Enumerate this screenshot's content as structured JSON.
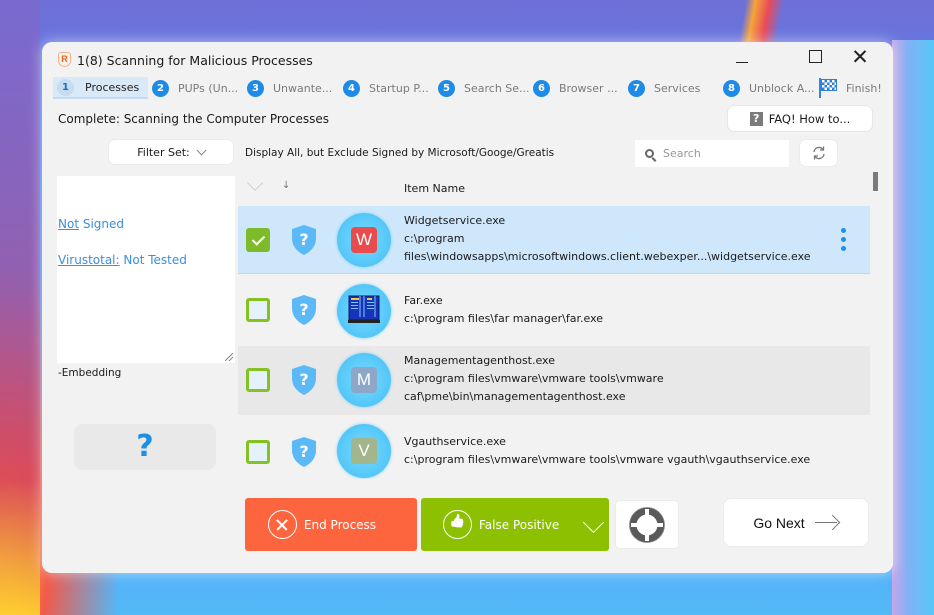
{
  "window": {
    "title": "1(8) Scanning for Malicious Processes",
    "app_icon_letter": "R",
    "close_glyph": "✕"
  },
  "steps": [
    {
      "num": "1",
      "label": "Processes",
      "active": true
    },
    {
      "num": "2",
      "label": "PUPs (Un..."
    },
    {
      "num": "3",
      "label": "Unwante..."
    },
    {
      "num": "4",
      "label": "Startup P..."
    },
    {
      "num": "5",
      "label": "Search Se..."
    },
    {
      "num": "6",
      "label": "Browser ..."
    },
    {
      "num": "7",
      "label": "Services"
    },
    {
      "num": "8",
      "label": "Unblock A..."
    },
    {
      "label": "Finish!",
      "icon": "checkered-flag-icon"
    }
  ],
  "status_text": "Complete: Scanning the Computer Processes",
  "faq": {
    "icon_glyph": "?",
    "label": "FAQ! How to..."
  },
  "filter": {
    "button_label": "Filter Set:",
    "description": "Display All, but Exclude Signed by Microsoft/Googe/Greatis"
  },
  "search": {
    "placeholder": "Search",
    "value": ""
  },
  "info_panel": {
    "signed_link": "Not",
    "signed_text": " Signed",
    "virustotal_link": "Virustotal:",
    "virustotal_text": " Not Tested",
    "embedding_text": "-Embedding",
    "help_glyph": "?"
  },
  "list": {
    "header": {
      "sort_glyph": "↓",
      "name_column": "Item Name"
    },
    "items": [
      {
        "name": "Widgetservice.exe",
        "path_line1": "c:\\program",
        "path_line2": "files\\windowsapps\\microsoftwindows.client.webexper...\\widgetservice.exe",
        "checked": true,
        "icon_letter": "W",
        "icon_color": "#e84c4c",
        "selected": true
      },
      {
        "name": "Far.exe",
        "path_line1": "c:\\program files\\far manager\\far.exe",
        "path_line2": "",
        "checked": false,
        "icon": "far-manager-icon"
      },
      {
        "name": "Managementagenthost.exe",
        "path_line1": "c:\\program files\\vmware\\vmware tools\\vmware",
        "path_line2": "caf\\pme\\bin\\managementagenthost.exe",
        "checked": false,
        "icon_letter": "M",
        "icon_color": "#8ea7c8"
      },
      {
        "name": "Vgauthservice.exe",
        "path_line1": "c:\\program files\\vmware\\vmware tools\\vmware vgauth\\vgauthservice.exe",
        "path_line2": "",
        "checked": false,
        "icon_letter": "V",
        "icon_color": "#a3b58c"
      }
    ]
  },
  "actions": {
    "end_process": "End Process",
    "false_positive": "False Positive",
    "go_next": "Go Next"
  },
  "colors": {
    "accent_blue": "#1e8be6",
    "end_process": "#fd653e",
    "false_positive": "#8dc000",
    "checkbox_green": "#84c224",
    "selected_row": "#cfe7fb"
  }
}
